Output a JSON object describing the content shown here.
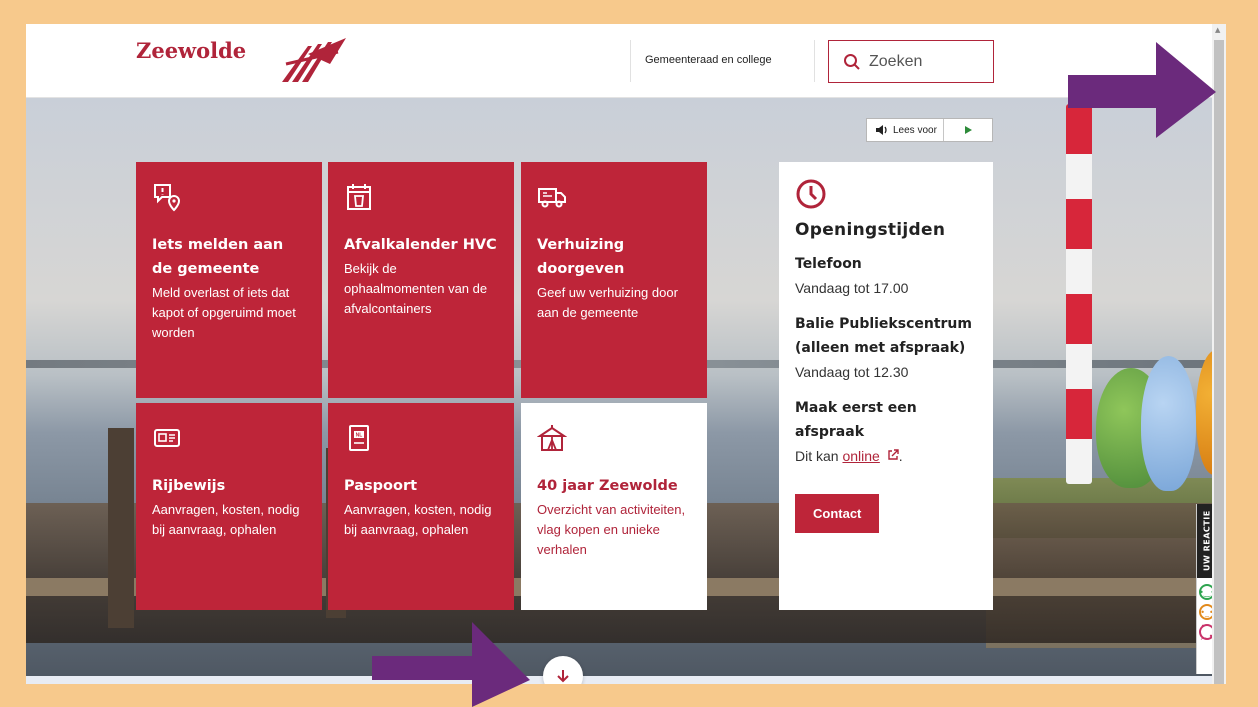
{
  "header": {
    "logo_text": "Zeewolde",
    "nav_link": "Gemeenteraad en college",
    "search_placeholder": "Zoeken"
  },
  "read_aloud": {
    "label": "Lees voor"
  },
  "tiles": [
    {
      "icon": "report-location-icon",
      "title": "Iets melden aan de gemeente",
      "desc": "Meld overlast of iets dat kapot of opgeruimd moet worden"
    },
    {
      "icon": "calendar-bin-icon",
      "title": "Afvalkalender HVC",
      "desc": "Bekijk de ophaalmomenten van de afvalcontainers"
    },
    {
      "icon": "moving-truck-icon",
      "title": "Verhuizing doorgeven",
      "desc": "Geef uw verhuizing door aan de gemeente"
    },
    {
      "icon": "id-card-icon",
      "title": "Rijbewijs",
      "desc": "Aanvragen, kosten, nodig bij aanvraag, ophalen"
    },
    {
      "icon": "passport-icon",
      "title": "Paspoort",
      "desc": "Aanvragen, kosten, nodig bij aanvraag, ophalen"
    },
    {
      "icon": "tent-icon",
      "title": "40 jaar Zeewolde",
      "desc": "Overzicht van activiteiten, vlag kopen en unieke verhalen"
    }
  ],
  "hours": {
    "title": "Openingstijden",
    "phone_label": "Telefoon",
    "phone_value": "Vandaag tot 17.00",
    "desk_label": "Balie Publiekscentrum (alleen met afspraak)",
    "desk_value": "Vandaag tot 12.30",
    "appt_label": "Maak eerst een afspraak",
    "appt_text_prefix": "Dit kan ",
    "appt_link": "online",
    "appt_suffix": ".",
    "contact_button": "Contact"
  },
  "feedback": {
    "label": "UW REACTIE"
  },
  "colors": {
    "brand": "#be2539",
    "annotation_arrow": "#6b2a7c",
    "border": "#f7c98c"
  }
}
